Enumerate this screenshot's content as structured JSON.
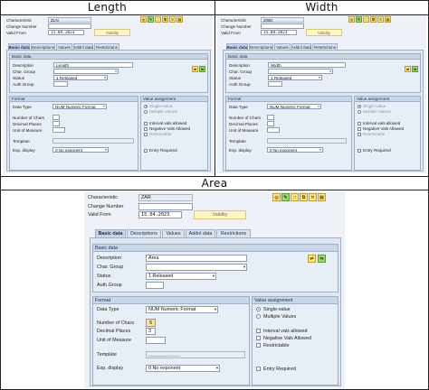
{
  "captions": {
    "length": "Length",
    "width": "Width",
    "area": "Area"
  },
  "labels": {
    "characteristic": "Characteristic",
    "change_number": "Change Number",
    "valid_from": "Valid From",
    "validity_button": "Validity",
    "basic_data_group": "Basic data",
    "description": "Description",
    "char_group": "Char. Group",
    "status": "Status",
    "auth_group": "Auth.Group",
    "format_group": "Format",
    "data_type": "Data Type",
    "number_of_chars": "Number of Chars",
    "decimal_places": "Decimal Places",
    "unit_of_measure": "Unit of Measure",
    "template": "Template",
    "exp_display": "Exp. display",
    "value_assignment_group": "Value assignment",
    "single_value": "Single-value",
    "multiple_values": "Multiple Values",
    "interval_vals": "Interval vals allowed",
    "negative_vals": "Negative Vals Allowed",
    "restrictable": "Restrictable",
    "entry_required": "Entry Required"
  },
  "tabs": [
    "Basic data",
    "Descriptions",
    "Values",
    "Addnl data",
    "Restrictions"
  ],
  "length": {
    "characteristic": "ZLN",
    "valid_from": "15.04.2023",
    "description": "Length",
    "status": "1 Released",
    "data_type": "NUM Numeric Format",
    "template": "______",
    "exp_display": "0 No exponent"
  },
  "width": {
    "characteristic": "ZWD",
    "valid_from": "15.04.2023",
    "description": "Width",
    "status": "1 Released",
    "data_type": "NUM Numeric Format",
    "template": "______",
    "exp_display": "0 No exponent"
  },
  "area": {
    "characteristic": "ZAR",
    "valid_from": "15.04.2023",
    "description": "Area",
    "status": "1 Released",
    "data_type": "NUM Numeric Format",
    "number_of_chars": "5",
    "decimal_places": "3",
    "template": "_________,___",
    "exp_display": "0 No exponent"
  },
  "colors": {
    "tab_active": "#c5d4e8",
    "group_header": "#c9d6e8",
    "validity_button": "#fff6c8",
    "toolbar_icon": "#ffe680"
  },
  "icons": [
    "display-icon",
    "edit-icon",
    "create-icon",
    "copy-icon",
    "delete-icon",
    "other-icon"
  ]
}
